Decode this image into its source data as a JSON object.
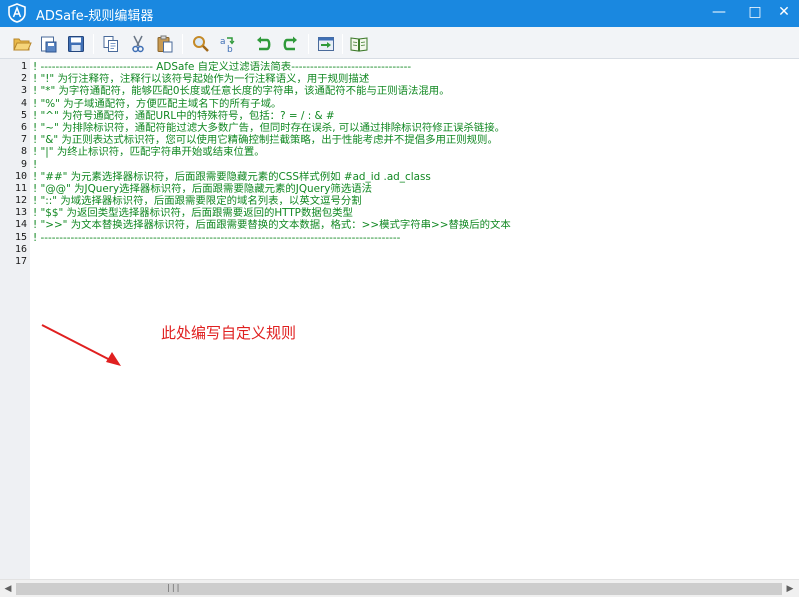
{
  "window": {
    "title": "ADSafe-规则编辑器",
    "controls": {
      "minimize": "—",
      "maximize": "□",
      "close": "✕"
    },
    "accent_color": "#1a88e0"
  },
  "toolbar": {
    "buttons": [
      {
        "icon": "open-folder-icon"
      },
      {
        "icon": "save-as-icon"
      },
      {
        "icon": "save-icon"
      },
      {
        "icon": "copy-icon"
      },
      {
        "icon": "cut-icon"
      },
      {
        "icon": "paste-icon"
      },
      {
        "icon": "find-icon"
      },
      {
        "icon": "replace-icon"
      },
      {
        "icon": "undo-icon"
      },
      {
        "icon": "redo-icon"
      },
      {
        "icon": "import-icon"
      },
      {
        "icon": "help-book-icon"
      }
    ]
  },
  "editor": {
    "text_color": "#118822",
    "lines": [
      {
        "num": "1",
        "text": "! ------------------------------ ADSafe 自定义过滤语法简表--------------------------------"
      },
      {
        "num": "2",
        "text": "! \"!\" 为行注释符，注释行以该符号起始作为一行注释语义，用于规则描述"
      },
      {
        "num": "3",
        "text": "! \"*\" 为字符通配符，能够匹配0长度或任意长度的字符串，该通配符不能与正则语法混用。"
      },
      {
        "num": "4",
        "text": "! \"%\" 为子域通配符，方便匹配主域名下的所有子域。"
      },
      {
        "num": "5",
        "text": "! \"^\" 为符号通配符，通配URL中的特殊符号，包括：? = / : & #"
      },
      {
        "num": "6",
        "text": "! \"~\" 为排除标识符，通配符能过滤大多数广告，但同时存在误杀, 可以通过排除标识符修正误杀链接。"
      },
      {
        "num": "7",
        "text": "! \"&\" 为正则表达式标识符，您可以使用它精确控制拦截策略，出于性能考虑并不提倡多用正则规则。"
      },
      {
        "num": "8",
        "text": "! \"|\" 为终止标识符，匹配字符串开始或结束位置。"
      },
      {
        "num": "9",
        "text": "!"
      },
      {
        "num": "10",
        "text": "! \"##\" 为元素选择器标识符，后面跟需要隐藏元素的CSS样式例如 #ad_id  .ad_class"
      },
      {
        "num": "11",
        "text": "! \"@@\" 为JQuery选择器标识符，后面跟需要隐藏元素的JQuery筛选语法"
      },
      {
        "num": "12",
        "text": "! \"::\" 为域选择器标识符，后面跟需要限定的域名列表，以英文逗号分割"
      },
      {
        "num": "13",
        "text": "! \"$$\" 为返回类型选择器标识符，后面跟需要返回的HTTP数据包类型"
      },
      {
        "num": "14",
        "text": "! \">>\" 为文本替换选择器标识符，后面跟需要替换的文本数据，格式：>>模式字符串>>替换后的文本"
      },
      {
        "num": "15",
        "text": "! ------------------------------------------------------------------------------------------------"
      },
      {
        "num": "16",
        "text": ""
      },
      {
        "num": "17",
        "text": ""
      }
    ]
  },
  "annotation": {
    "text": "此处编写自定义规则",
    "color": "#e02020"
  },
  "scrollbar": {
    "left_arrow": "◀",
    "right_arrow": "▶",
    "grip": "|||"
  }
}
